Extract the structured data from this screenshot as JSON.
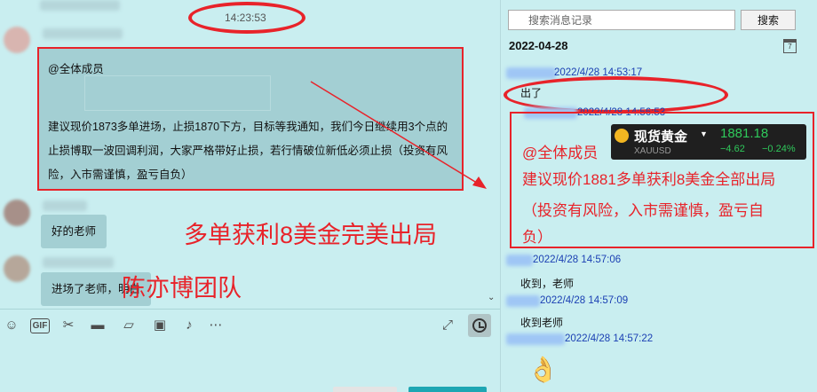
{
  "chat": {
    "timestamp": "14:23:53",
    "main_message": {
      "mention": "@全体成员",
      "body": "建议现价1873多单进场，止损1870下方，目标等我通知，我们今日继续用3个点的止损博取一波回调利润，大家严格带好止损，若行情破位新低必须止损（投资有风险，入市需谨慎，盈亏自负）"
    },
    "reply_1": "好的老师",
    "reply_2": "进场了老师，明白",
    "annotation_1": "多单获利8美金完美出局",
    "annotation_2": "陈亦博团队",
    "scroll_down_glyph": "⌄"
  },
  "toolbar": {
    "gif_label": "GIF"
  },
  "history": {
    "search_placeholder": "搜索消息记录",
    "search_button": "搜索",
    "date": "2022-04-28",
    "calendar_day": "7",
    "entries": [
      {
        "time": "2022/4/28 14:53:17",
        "text": "出了"
      },
      {
        "time": "2022/4/28 14:56:53"
      },
      {
        "time": "2022/4/28 14:57:06",
        "text": "收到，老师"
      },
      {
        "time": "2022/4/28 14:57:09",
        "text": "收到老师"
      },
      {
        "time": "2022/4/28 14:57:22"
      }
    ],
    "highlight": {
      "line1": "@全体成员",
      "line2": "建议现价1881多单获利8美金全部出局",
      "line3": "（投资有风险，入市需谨慎，盈亏自",
      "line4": "负）"
    },
    "gold_widget": {
      "name": "现货黄金",
      "symbol": "XAUUSD",
      "price": "1881.18",
      "change": "−4.62",
      "change_pct": "−0.24%"
    }
  },
  "colors": {
    "annotation_red": "#e8232a",
    "chat_background": "#c9eef0",
    "bubble": "#a3cfd3",
    "history_time": "#1a3fb3",
    "gold_up": "#2fc95b"
  }
}
